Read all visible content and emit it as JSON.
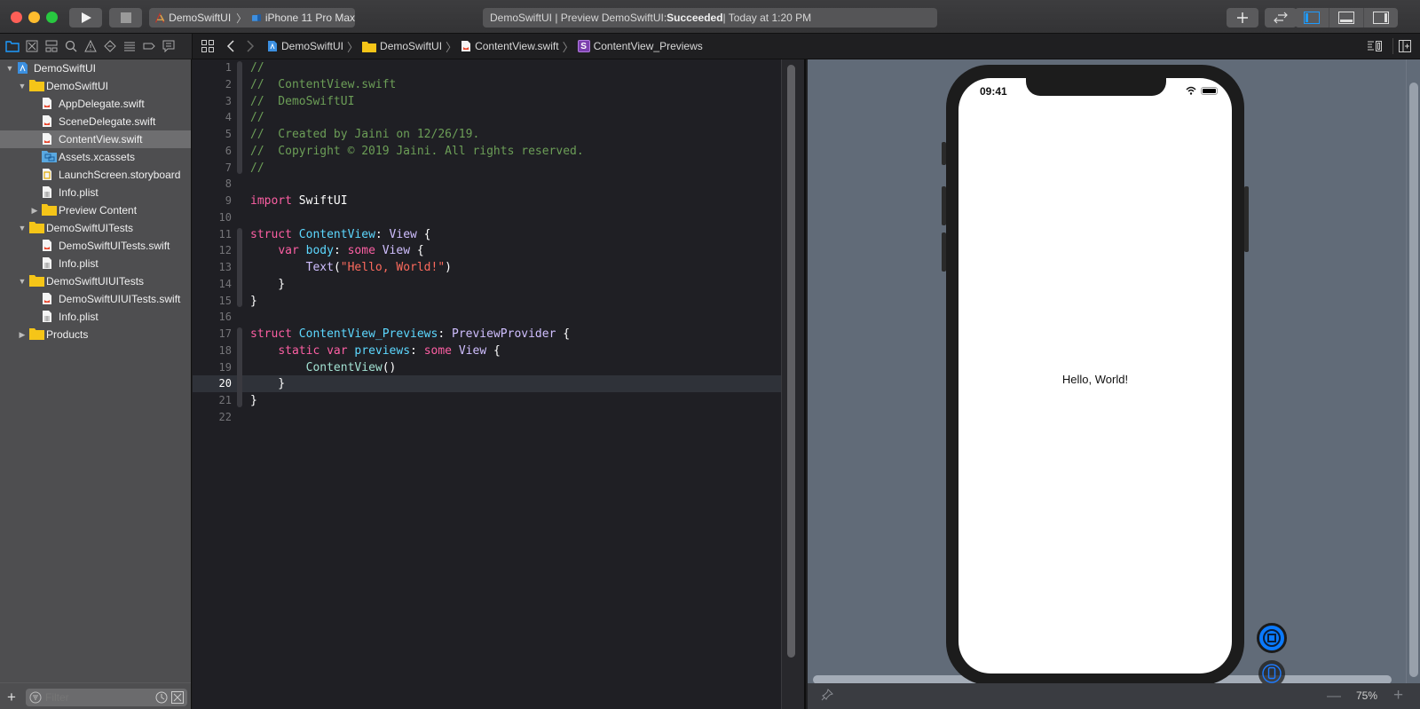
{
  "toolbar": {
    "scheme_project": "DemoSwiftUI",
    "scheme_device": "iPhone 11 Pro Max",
    "activity_prefix": "DemoSwiftUI | Preview DemoSwiftUI: ",
    "activity_status": "Succeeded",
    "activity_time": " | Today at 1:20 PM"
  },
  "navigator_tabs": [
    {
      "name": "project-navigator",
      "active": true
    },
    {
      "name": "source-control-navigator"
    },
    {
      "name": "symbol-navigator"
    },
    {
      "name": "find-navigator"
    },
    {
      "name": "issue-navigator"
    },
    {
      "name": "test-navigator"
    },
    {
      "name": "debug-navigator"
    },
    {
      "name": "breakpoint-navigator"
    },
    {
      "name": "report-navigator"
    }
  ],
  "jumpbar": {
    "items": [
      "DemoSwiftUI",
      "DemoSwiftUI",
      "ContentView.swift",
      "ContentView_Previews"
    ],
    "struct_badge": "S"
  },
  "sidebar": {
    "tree": [
      {
        "label": "DemoSwiftUI",
        "icon": "project",
        "level": 0,
        "disclosure": "open"
      },
      {
        "label": "DemoSwiftUI",
        "icon": "folder",
        "level": 1,
        "disclosure": "open"
      },
      {
        "label": "AppDelegate.swift",
        "icon": "swift",
        "level": 2
      },
      {
        "label": "SceneDelegate.swift",
        "icon": "swift",
        "level": 2
      },
      {
        "label": "ContentView.swift",
        "icon": "swift",
        "level": 2,
        "selected": true
      },
      {
        "label": "Assets.xcassets",
        "icon": "assets",
        "level": 2
      },
      {
        "label": "LaunchScreen.storyboard",
        "icon": "storyboard",
        "level": 2
      },
      {
        "label": "Info.plist",
        "icon": "plist",
        "level": 2
      },
      {
        "label": "Preview Content",
        "icon": "folder",
        "level": 2,
        "disclosure": "closed"
      },
      {
        "label": "DemoSwiftUITests",
        "icon": "folder",
        "level": 1,
        "disclosure": "open"
      },
      {
        "label": "DemoSwiftUITests.swift",
        "icon": "swift",
        "level": 2
      },
      {
        "label": "Info.plist",
        "icon": "plist",
        "level": 2
      },
      {
        "label": "DemoSwiftUIUITests",
        "icon": "folder",
        "level": 1,
        "disclosure": "open"
      },
      {
        "label": "DemoSwiftUIUITests.swift",
        "icon": "swift",
        "level": 2
      },
      {
        "label": "Info.plist",
        "icon": "plist",
        "level": 2
      },
      {
        "label": "Products",
        "icon": "folder",
        "level": 1,
        "disclosure": "closed"
      }
    ],
    "filter_placeholder": "Filter"
  },
  "editor": {
    "current_line": 20,
    "lines": [
      [
        [
          "t-com",
          "//"
        ]
      ],
      [
        [
          "t-com",
          "//  ContentView.swift"
        ]
      ],
      [
        [
          "t-com",
          "//  DemoSwiftUI"
        ]
      ],
      [
        [
          "t-com",
          "//"
        ]
      ],
      [
        [
          "t-com",
          "//  Created by Jaini on 12/26/19."
        ]
      ],
      [
        [
          "t-com",
          "//  Copyright © 2019 Jaini. All rights reserved."
        ]
      ],
      [
        [
          "t-com",
          "//"
        ]
      ],
      [],
      [
        [
          "t-kw",
          "import"
        ],
        [
          "t-plain",
          " SwiftUI"
        ]
      ],
      [],
      [
        [
          "t-kw",
          "struct"
        ],
        [
          "t-plain",
          " "
        ],
        [
          "t-type",
          "ContentView"
        ],
        [
          "t-plain",
          ": "
        ],
        [
          "t-cls",
          "View"
        ],
        [
          "t-plain",
          " {"
        ]
      ],
      [
        [
          "t-plain",
          "    "
        ],
        [
          "t-kw",
          "var"
        ],
        [
          "t-plain",
          " "
        ],
        [
          "t-type",
          "body"
        ],
        [
          "t-plain",
          ": "
        ],
        [
          "t-kw",
          "some"
        ],
        [
          "t-plain",
          " "
        ],
        [
          "t-cls",
          "View"
        ],
        [
          "t-plain",
          " {"
        ]
      ],
      [
        [
          "t-plain",
          "        "
        ],
        [
          "t-cls",
          "Text"
        ],
        [
          "t-plain",
          "("
        ],
        [
          "t-str",
          "\"Hello, World!\""
        ],
        [
          "t-plain",
          ")"
        ]
      ],
      [
        [
          "t-plain",
          "    }"
        ]
      ],
      [
        [
          "t-plain",
          "}"
        ]
      ],
      [],
      [
        [
          "t-kw",
          "struct"
        ],
        [
          "t-plain",
          " "
        ],
        [
          "t-type",
          "ContentView_Previews"
        ],
        [
          "t-plain",
          ": "
        ],
        [
          "t-cls",
          "PreviewProvider"
        ],
        [
          "t-plain",
          " {"
        ]
      ],
      [
        [
          "t-plain",
          "    "
        ],
        [
          "t-kw",
          "static"
        ],
        [
          "t-plain",
          " "
        ],
        [
          "t-kw",
          "var"
        ],
        [
          "t-plain",
          " "
        ],
        [
          "t-type",
          "previews"
        ],
        [
          "t-plain",
          ": "
        ],
        [
          "t-kw",
          "some"
        ],
        [
          "t-plain",
          " "
        ],
        [
          "t-cls",
          "View"
        ],
        [
          "t-plain",
          " {"
        ]
      ],
      [
        [
          "t-plain",
          "        "
        ],
        [
          "t-fn",
          "ContentView"
        ],
        [
          "t-plain",
          "()"
        ]
      ],
      [
        [
          "t-plain",
          "    }"
        ]
      ],
      [
        [
          "t-plain",
          "}"
        ]
      ],
      []
    ]
  },
  "preview": {
    "status_time": "09:41",
    "content_text": "Hello, World!",
    "battery_level": 1.0,
    "zoom_level": "75%"
  }
}
